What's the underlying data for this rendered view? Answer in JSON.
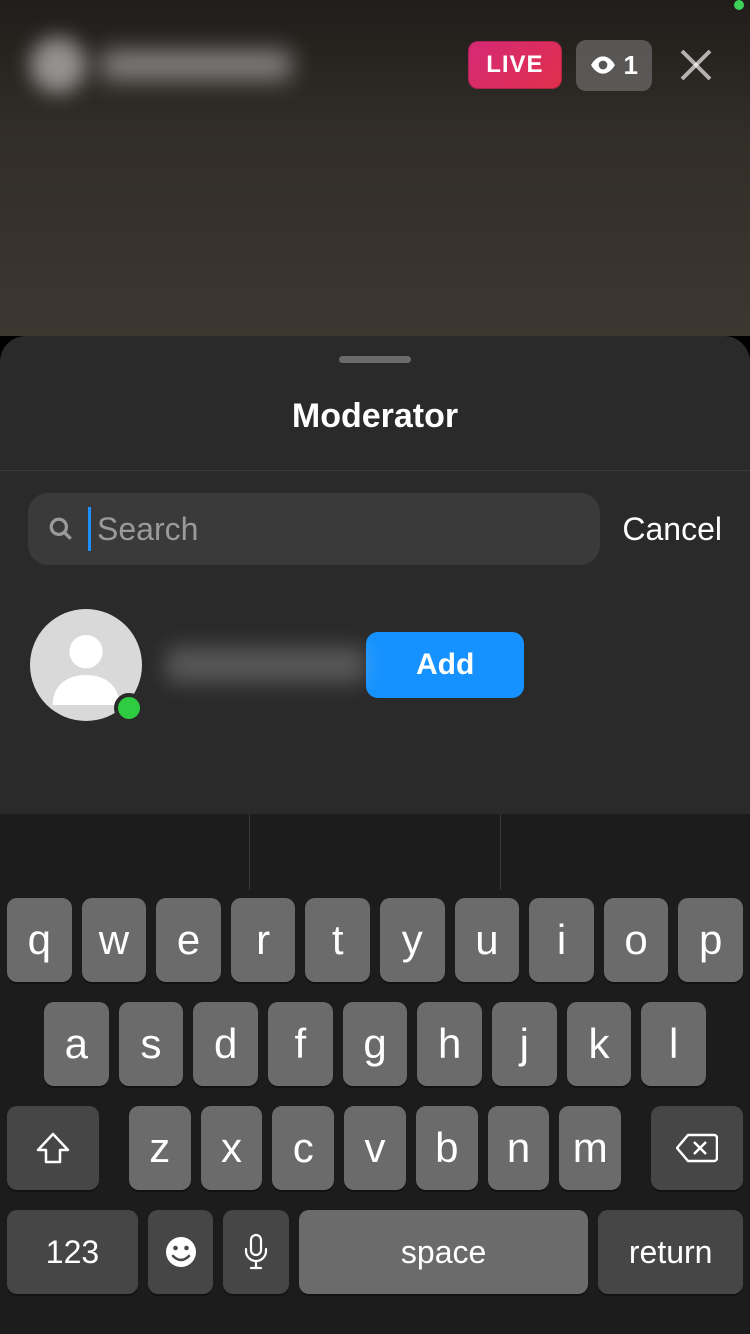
{
  "header": {
    "live_label": "LIVE",
    "viewer_count": "1"
  },
  "sheet": {
    "title": "Moderator",
    "search_placeholder": "Search",
    "cancel_label": "Cancel",
    "users": [
      {
        "add_label": "Add",
        "online": true
      }
    ]
  },
  "keyboard": {
    "rows": [
      [
        "q",
        "w",
        "e",
        "r",
        "t",
        "y",
        "u",
        "i",
        "o",
        "p"
      ],
      [
        "a",
        "s",
        "d",
        "f",
        "g",
        "h",
        "j",
        "k",
        "l"
      ],
      [
        "z",
        "x",
        "c",
        "v",
        "b",
        "n",
        "m"
      ]
    ],
    "num_label": "123",
    "space_label": "space",
    "return_label": "return"
  }
}
